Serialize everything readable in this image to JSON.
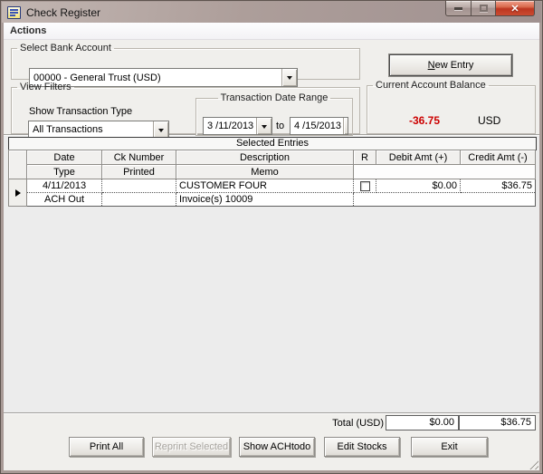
{
  "window": {
    "title": "Check Register"
  },
  "menu": {
    "actions_label": "Actions"
  },
  "bank_account": {
    "group_label": "Select Bank Account",
    "selected": "00000 - General Trust (USD)"
  },
  "new_entry": {
    "mnemonic": "N",
    "rest": "ew Entry"
  },
  "balance": {
    "group_label": "Current Account Balance",
    "amount": "-36.75",
    "currency": "USD"
  },
  "view_filters": {
    "group_label": "View Filters",
    "transaction_type_label": "Show Transaction Type",
    "transaction_type_value": "All Transactions",
    "date_range_label": "Transaction Date Range",
    "date_from": "3 /11/2013",
    "to_label": "to",
    "date_to": "4 /15/2013"
  },
  "grid": {
    "caption": "Selected Entries",
    "headers": {
      "date": "Date",
      "ck_number": "Ck Number",
      "description": "Description",
      "r": "R",
      "debit": "Debit Amt (+)",
      "credit": "Credit Amt (-)",
      "type": "Type",
      "printed": "Printed",
      "memo": "Memo"
    },
    "entries": [
      {
        "date": "4/11/2013",
        "ck_number": "",
        "description": "CUSTOMER FOUR",
        "reconciled": false,
        "debit": "$0.00",
        "credit": "$36.75",
        "type": "ACH Out",
        "printed": "",
        "memo": "Invoice(s) 10009"
      }
    ]
  },
  "totals": {
    "label": "Total (USD)",
    "debit": "$0.00",
    "credit": "$36.75"
  },
  "footer_buttons": {
    "print_all": "Print All",
    "reprint_selected": "Reprint Selected",
    "show_achtodo": "Show ACHtodo",
    "edit_stocks": "Edit Stocks",
    "exit": "Exit"
  },
  "colors": {
    "negative_amount": "#cc0000",
    "titlebar": "#a89a96",
    "close_button": "#bd3620"
  }
}
